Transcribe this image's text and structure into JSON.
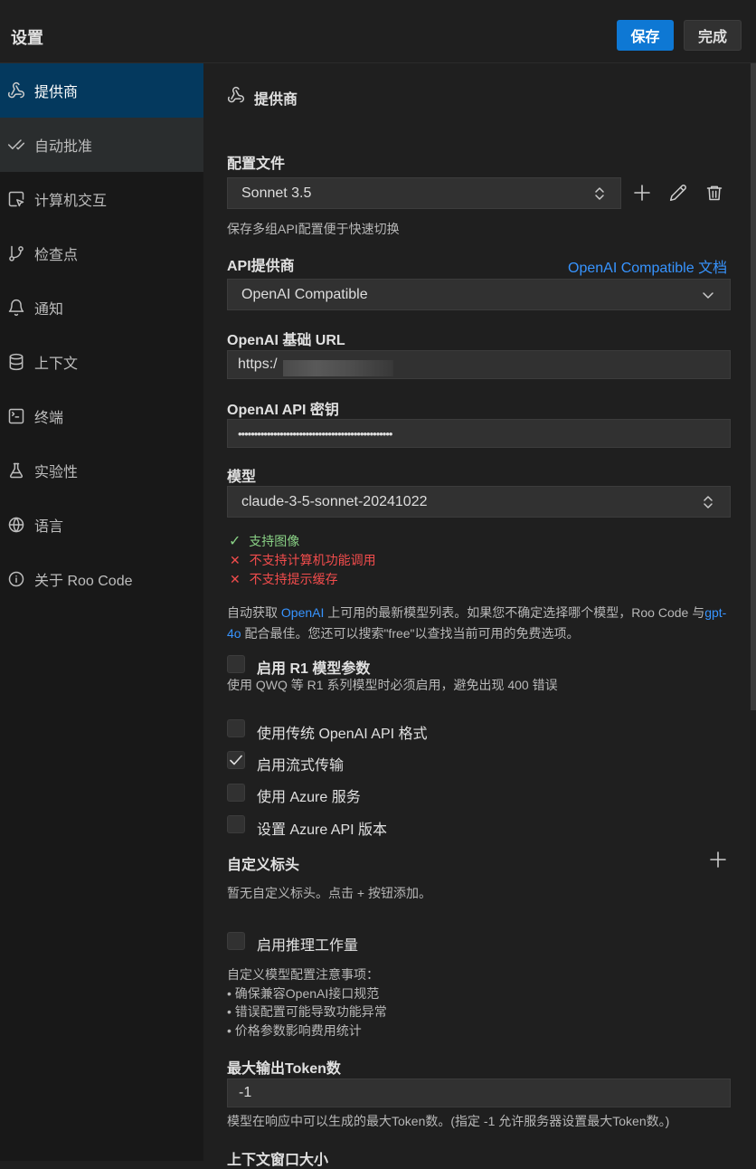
{
  "header": {
    "title": "设置",
    "save": "保存",
    "done": "完成"
  },
  "sidebar": {
    "items": [
      {
        "label": "提供商",
        "icon": "webhook-icon"
      },
      {
        "label": "自动批准",
        "icon": "check-check-icon"
      },
      {
        "label": "计算机交互",
        "icon": "pointer-square-icon"
      },
      {
        "label": "检查点",
        "icon": "git-branch-icon"
      },
      {
        "label": "通知",
        "icon": "bell-icon"
      },
      {
        "label": "上下文",
        "icon": "database-icon"
      },
      {
        "label": "终端",
        "icon": "terminal-icon"
      },
      {
        "label": "实验性",
        "icon": "flask-icon"
      },
      {
        "label": "语言",
        "icon": "globe-icon"
      },
      {
        "label": "关于 Roo Code",
        "icon": "info-icon"
      }
    ]
  },
  "main": {
    "section_title": "提供商",
    "profile": {
      "label": "配置文件",
      "value": "Sonnet 3.5",
      "hint": "保存多组API配置便于快速切换"
    },
    "provider": {
      "label": "API提供商",
      "doc_link": "OpenAI Compatible 文档",
      "value": "OpenAI Compatible"
    },
    "base_url": {
      "label": "OpenAI 基础 URL",
      "value": "https:/"
    },
    "api_key": {
      "label": "OpenAI API 密钥",
      "value": "••••••••••••••••••••••••••••••••••••••••••••••••"
    },
    "model": {
      "label": "模型",
      "value": "claude-3-5-sonnet-20241022"
    },
    "capabilities": [
      {
        "mark": "✓",
        "text": "支持图像",
        "color": "#89d185"
      },
      {
        "mark": "✕",
        "text": "不支持计算机功能调用",
        "color": "#f14c4c"
      },
      {
        "mark": "✕",
        "text": "不支持提示缓存",
        "color": "#f14c4c"
      }
    ],
    "model_info": {
      "p1": "自动获取 ",
      "link1": "OpenAI",
      "p2": " 上可用的最新模型列表。如果您不确定选择哪个模型，Roo Code 与",
      "link2": "gpt-4o",
      "p3": " 配合最佳。您还可以搜索\"free\"以查找当前可用的免费选项。"
    },
    "r1": {
      "label": "启用 R1 模型参数",
      "desc": "使用 QWQ 等 R1 系列模型时必须启用，避免出现 400 错误",
      "checked": false
    },
    "legacy_format": {
      "label": "使用传统 OpenAI API 格式",
      "checked": false
    },
    "streaming": {
      "label": "启用流式传输",
      "checked": true
    },
    "azure": {
      "label": "使用 Azure 服务",
      "checked": false
    },
    "azure_version": {
      "label": "设置 Azure API 版本",
      "checked": false
    },
    "custom_headers": {
      "label": "自定义标头",
      "empty": "暂无自定义标头。点击 + 按钮添加。"
    },
    "reasoning": {
      "label": "启用推理工作量",
      "checked": false
    },
    "notes": {
      "title": "自定义模型配置注意事项：",
      "items": [
        "• 确保兼容OpenAI接口规范",
        "• 错误配置可能导致功能异常",
        "• 价格参数影响费用统计"
      ]
    },
    "max_tokens": {
      "label": "最大输出Token数",
      "value": "-1",
      "desc": "模型在响应中可以生成的最大Token数。(指定 -1 允许服务器设置最大Token数。)"
    },
    "context_window": {
      "label": "上下文窗口大小"
    }
  },
  "colors": {
    "accent": "#0e78d4",
    "active_nav": "#04395e",
    "link": "#3794ff",
    "success": "#89d185",
    "error": "#f14c4c"
  }
}
